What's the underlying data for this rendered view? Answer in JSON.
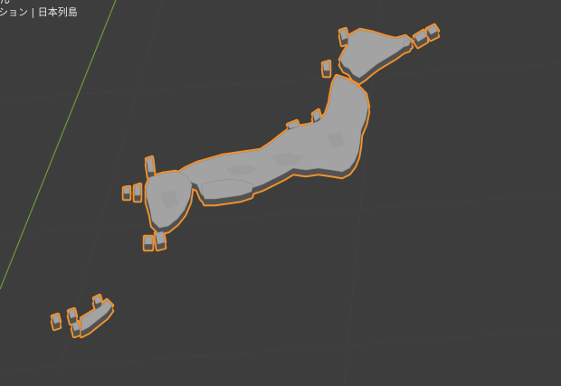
{
  "viewport": {
    "header_fragment": "ん",
    "object_info": "ション | 日本列島"
  },
  "scene": {
    "object_name": "日本列島",
    "selected": true,
    "colors": {
      "background": "#3d3d3d",
      "grid_line": "#474747",
      "y_axis": "#6f9a34",
      "mesh_top": "#a3a3a3",
      "mesh_side": "#565656",
      "selection_outline": "#f2922e"
    }
  }
}
